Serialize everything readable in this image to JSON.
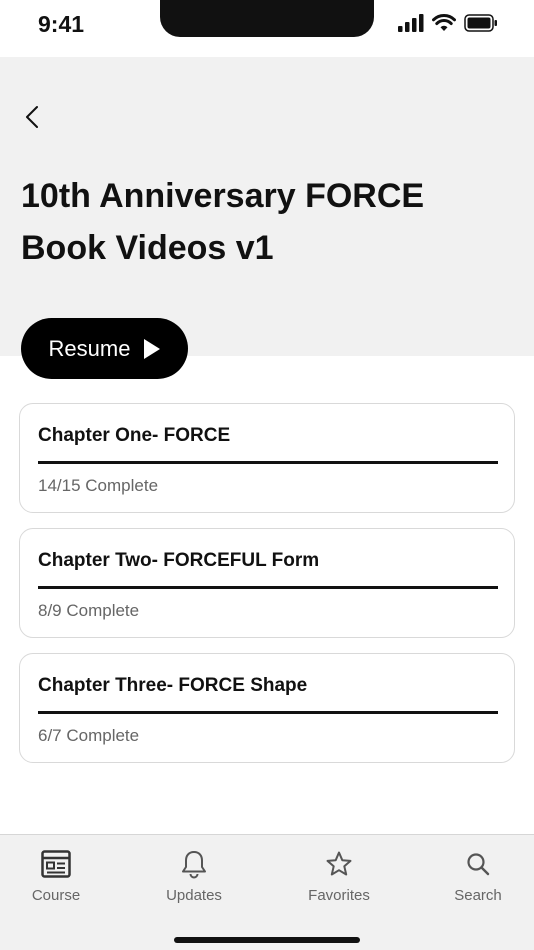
{
  "status_bar": {
    "time": "9:41"
  },
  "header": {
    "title": "10th Anniversary FORCE Book Videos v1",
    "resume_label": "Resume",
    "background": "#f1f1f1"
  },
  "chapters": [
    {
      "title": "Chapter One- FORCE",
      "status": "14/15 Complete",
      "progress": 1.0
    },
    {
      "title": "Chapter Two- FORCEFUL Form",
      "status": "8/9 Complete",
      "progress": 1.0
    },
    {
      "title": "Chapter Three- FORCE Shape",
      "status": "6/7 Complete",
      "progress": 1.0
    }
  ],
  "tab_bar": {
    "tabs": [
      {
        "label": "Course",
        "icon": "course-icon"
      },
      {
        "label": "Updates",
        "icon": "bell-icon"
      },
      {
        "label": "Favorites",
        "icon": "star-icon"
      },
      {
        "label": "Search",
        "icon": "search-icon"
      }
    ]
  },
  "colors": {
    "accent": "#000000",
    "muted_text": "#666666",
    "card_border": "#d9d9d9"
  }
}
